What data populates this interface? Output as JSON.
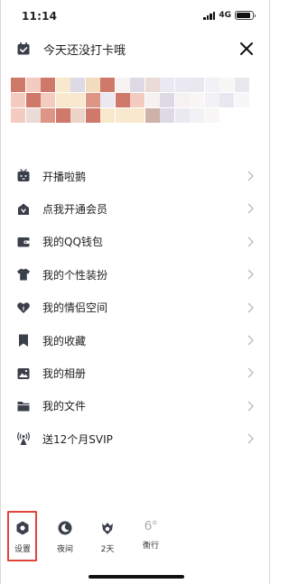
{
  "status_bar": {
    "time": "11:14",
    "network": "4G",
    "battery_level": 0.9
  },
  "header": {
    "title": "今天还没打卡哦",
    "close_icon": "close-icon"
  },
  "profile": {
    "blurred": true
  },
  "menu": {
    "items": [
      {
        "label": "开播啦鹅",
        "icon": "live-tv-icon"
      },
      {
        "label": "点我开通会员",
        "icon": "vip-crown-icon"
      },
      {
        "label": "我的QQ钱包",
        "icon": "wallet-icon"
      },
      {
        "label": "我的个性装扮",
        "icon": "tshirt-icon"
      },
      {
        "label": "我的情侣空间",
        "icon": "heart-icon"
      },
      {
        "label": "我的收藏",
        "icon": "bookmark-icon"
      },
      {
        "label": "我的相册",
        "icon": "photo-icon"
      },
      {
        "label": "我的文件",
        "icon": "folder-icon"
      },
      {
        "label": "送12个月SVIP",
        "icon": "antenna-icon"
      }
    ]
  },
  "bottom_bar": {
    "settings": "设置",
    "night": "夜间",
    "days": "2天",
    "weather_temp": "6°",
    "weather_city": "衡行"
  },
  "colors": {
    "highlight": "#e0443a",
    "icon": "#3a3f4a",
    "chevron": "#b9b9b9"
  }
}
